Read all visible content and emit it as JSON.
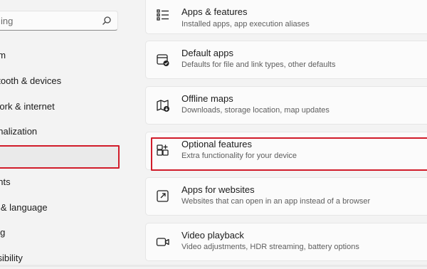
{
  "search": {
    "placeholder": "ing"
  },
  "sidebar": {
    "items": [
      {
        "label": "em"
      },
      {
        "label": "otooth & devices"
      },
      {
        "label": "work & internet"
      },
      {
        "label": "onalization"
      },
      {
        "label": ""
      },
      {
        "label": "unts"
      },
      {
        "label": "e & language"
      },
      {
        "label": "ing"
      },
      {
        "label": "ssibility"
      }
    ]
  },
  "cards": [
    {
      "title": "Apps & features",
      "desc": "Installed apps, app execution aliases",
      "icon": "apps-list-icon"
    },
    {
      "title": "Default apps",
      "desc": "Defaults for file and link types, other defaults",
      "icon": "default-apps-icon"
    },
    {
      "title": "Offline maps",
      "desc": "Downloads, storage location, map updates",
      "icon": "offline-maps-icon"
    },
    {
      "title": "Optional features",
      "desc": "Extra functionality for your device",
      "icon": "optional-features-icon"
    },
    {
      "title": "Apps for websites",
      "desc": "Websites that can open in an app instead of a browser",
      "icon": "apps-for-websites-icon"
    },
    {
      "title": "Video playback",
      "desc": "Video adjustments, HDR streaming, battery options",
      "icon": "video-playback-icon"
    }
  ],
  "colors": {
    "highlight": "#d11c2a",
    "background": "#f3f3f3",
    "card": "#fbfbfb"
  }
}
